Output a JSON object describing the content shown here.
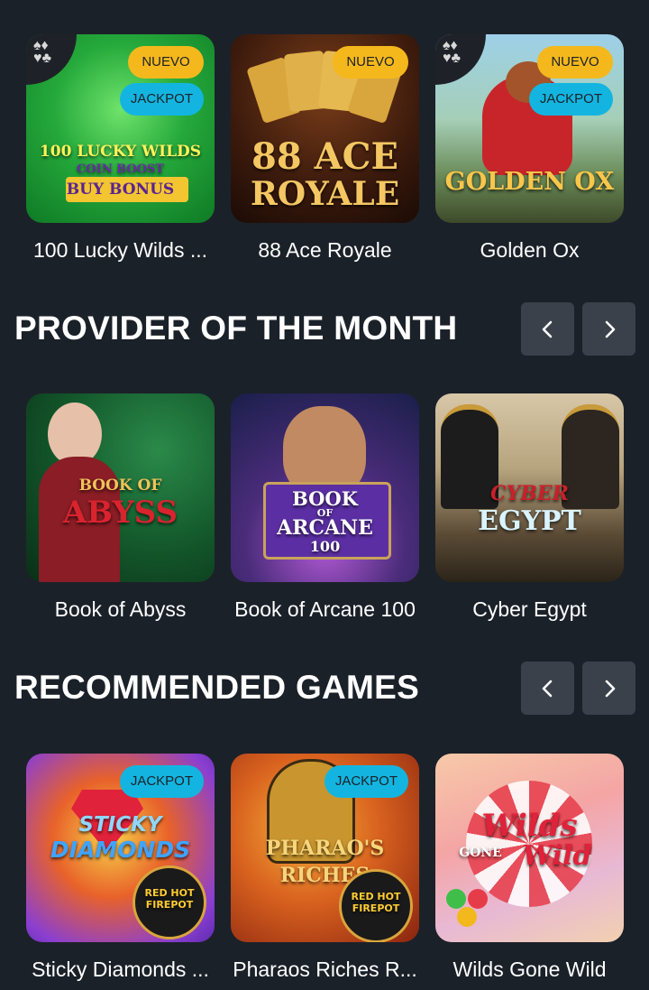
{
  "row1": {
    "games": [
      {
        "title": "100 Lucky Wilds ...",
        "badges": [
          "NUEVO",
          "JACKPOT"
        ],
        "art_lines": [
          "100 LUCKY WILDS",
          "COIN BOOST",
          "BUY BONUS"
        ]
      },
      {
        "title": "88 Ace Royale",
        "badges": [
          "NUEVO"
        ],
        "art_lines": [
          "88 ACE",
          "ROYALE"
        ]
      },
      {
        "title": "Golden Ox",
        "badges": [
          "NUEVO",
          "JACKPOT"
        ],
        "art_lines": [
          "GOLDEN OX"
        ]
      }
    ]
  },
  "provider_section": {
    "title": "PROVIDER OF THE MONTH",
    "games": [
      {
        "title": "Book of Abyss",
        "art_lines": [
          "BOOK OF",
          "ABYSS"
        ]
      },
      {
        "title": "Book of Arcane 100",
        "art_lines": [
          "BOOK",
          "OF",
          "ARCANE",
          "100"
        ]
      },
      {
        "title": "Cyber Egypt",
        "art_lines": [
          "CYBER",
          "EGYPT"
        ]
      }
    ]
  },
  "recommended_section": {
    "title": "RECOMMENDED GAMES",
    "games": [
      {
        "title": "Sticky Diamonds ...",
        "badges": [
          "JACKPOT"
        ],
        "art_lines": [
          "STICKY",
          "DIAMONDS",
          "RED HOT FIREPOT"
        ]
      },
      {
        "title": "Pharaos Riches R...",
        "badges": [
          "JACKPOT"
        ],
        "art_lines": [
          "PHARAO'S",
          "RICHES",
          "RED HOT FIREPOT"
        ]
      },
      {
        "title": "Wilds Gone Wild",
        "art_lines": [
          "Wilds",
          "GONE",
          "Wild"
        ]
      }
    ]
  },
  "icons": {
    "prev": "chevron-left-icon",
    "next": "chevron-right-icon"
  },
  "colors": {
    "background": "#1b2129",
    "nav_button": "#3a414b",
    "badge_nuevo": "#f5b81c",
    "badge_jackpot": "#13b5e0"
  }
}
